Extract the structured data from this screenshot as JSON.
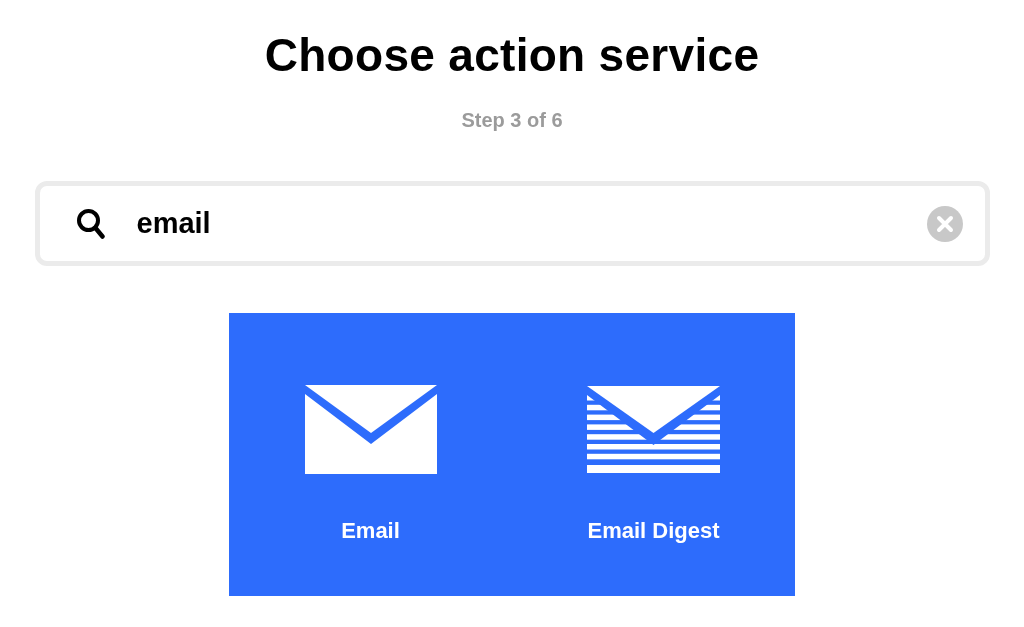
{
  "heading": {
    "title": "Choose action service",
    "step": "Step 3 of 6"
  },
  "search": {
    "value": "email"
  },
  "services": [
    {
      "name": "Email",
      "kind": "envelope"
    },
    {
      "name": "Email Digest",
      "kind": "digest"
    }
  ]
}
